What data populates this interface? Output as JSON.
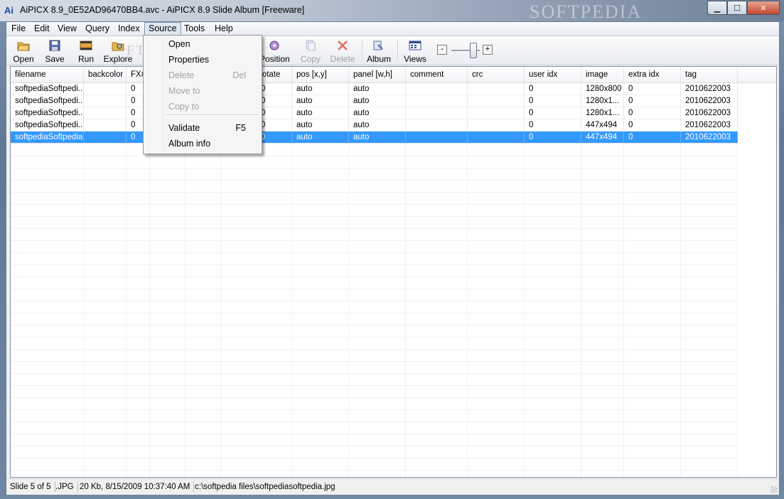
{
  "window": {
    "title": "AiPICX 8.9_0E52AD96470BB4.avc - AiPICX 8.9 Slide Album  [Freeware]",
    "icon_text": "Ai",
    "watermark": "SOFTPEDIA",
    "controls": [
      "minimize-icon",
      "maximize-icon",
      "close-icon"
    ]
  },
  "menu": {
    "items": [
      "File",
      "Edit",
      "View",
      "Query",
      "Index",
      "Source",
      "Tools",
      "Help"
    ],
    "active": "Source"
  },
  "toolbar": {
    "buttons": [
      {
        "label": "Open",
        "icon": "open-folder-icon",
        "enabled": true
      },
      {
        "label": "Save",
        "icon": "save-disk-icon",
        "enabled": true
      },
      {
        "label": "Run",
        "icon": "film-icon",
        "enabled": true
      },
      {
        "label": "Explore",
        "icon": "explore-folder-icon",
        "enabled": true
      },
      {
        "label": "Position",
        "icon": "position-icon",
        "enabled": true
      },
      {
        "label": "Copy",
        "icon": "copy-icon",
        "enabled": false
      },
      {
        "label": "Delete",
        "icon": "delete-x-icon",
        "enabled": false
      },
      {
        "label": "Album",
        "icon": "album-icon",
        "enabled": true
      },
      {
        "label": "Views",
        "icon": "views-icon",
        "enabled": true
      }
    ],
    "zoom_minus": "-",
    "zoom_plus": "+"
  },
  "source_menu": {
    "items": [
      {
        "label": "Open",
        "shortcut": "",
        "enabled": true
      },
      {
        "label": "Properties",
        "shortcut": "",
        "enabled": true
      },
      {
        "label": "Delete",
        "shortcut": "Del",
        "enabled": false
      },
      {
        "label": "Move to",
        "shortcut": "",
        "enabled": false
      },
      {
        "label": "Copy to",
        "shortcut": "",
        "enabled": false
      },
      {
        "label": "Validate",
        "shortcut": "F5",
        "enabled": true
      },
      {
        "label": "Album info",
        "shortcut": "",
        "enabled": true
      }
    ],
    "watermark": "FTPEDIA"
  },
  "grid": {
    "columns": [
      "filename",
      "backcolor",
      "FX#",
      "",
      "",
      "rotate",
      "pos [x,y]",
      "panel [w,h]",
      "comment",
      "crc",
      "user idx",
      "image",
      "extra idx",
      "tag"
    ],
    "rows": [
      [
        "softpediaSoftpedi...",
        "",
        "0",
        "",
        "",
        "0",
        "auto",
        "auto",
        "",
        "",
        "0",
        "1280x800",
        "0",
        "2010622003"
      ],
      [
        "softpediaSoftpedi...",
        "",
        "0",
        "",
        "",
        "0",
        "auto",
        "auto",
        "",
        "",
        "0",
        "1280x1...",
        "0",
        "2010622003"
      ],
      [
        "softpediaSoftpedi...",
        "",
        "0",
        "",
        "",
        "0",
        "auto",
        "auto",
        "",
        "",
        "0",
        "1280x1...",
        "0",
        "2010622003"
      ],
      [
        "softpediaSoftpedi...",
        "",
        "0",
        "",
        "",
        "0",
        "auto",
        "auto",
        "",
        "",
        "0",
        "447x494",
        "0",
        "2010622003"
      ],
      [
        "softpediaSoftpedia",
        "",
        "0",
        "",
        "",
        "0",
        "auto",
        "auto",
        "",
        "",
        "0",
        "447x494",
        "0",
        "2010622003"
      ]
    ],
    "selected_row": 4
  },
  "status": {
    "slide": "Slide 5 of 5",
    "ext": ".JPG",
    "info": "20 Kb, 8/15/2009 10:37:40 AM",
    "path": "c:\\softpedia files\\softpediasoftpedia.jpg"
  }
}
